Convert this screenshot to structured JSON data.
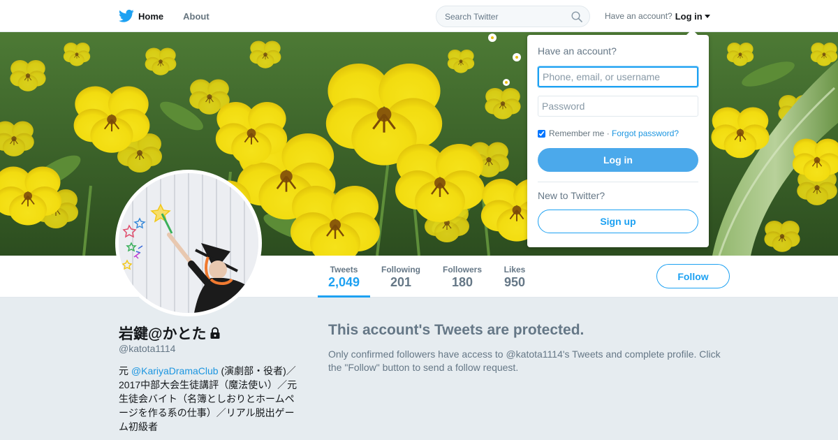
{
  "nav": {
    "home_label": "Home",
    "about_label": "About",
    "search_placeholder": "Search Twitter",
    "have_account_text": "Have an account?",
    "login_label": "Log in"
  },
  "profile": {
    "name": "岩鍵@かとた",
    "handle": "@katota1114",
    "bio_prefix": "元 ",
    "bio_mention": "@KariyaDramaClub",
    "bio_rest": " (演劇部・役者)／2017中部大会生徒講評（魔法使い）／元生徒会バイト（名簿としおりとホームページを作る系の仕事）／リアル脱出ゲーム初級者"
  },
  "stats": [
    {
      "label": "Tweets",
      "value": "2,049",
      "active": true
    },
    {
      "label": "Following",
      "value": "201",
      "active": false
    },
    {
      "label": "Followers",
      "value": "180",
      "active": false
    },
    {
      "label": "Likes",
      "value": "950",
      "active": false
    }
  ],
  "follow_label": "Follow",
  "protected": {
    "title": "This account's Tweets are protected.",
    "text": "Only confirmed followers have access to @katota1114's Tweets and complete profile. Click the \"Follow\" button to send a follow request."
  },
  "login_dropdown": {
    "heading": "Have an account?",
    "username_placeholder": "Phone, email, or username",
    "password_placeholder": "Password",
    "remember_label": "Remember me",
    "separator": " · ",
    "forgot_label": "Forgot password?",
    "remember_checked": true,
    "login_button": "Log in",
    "new_heading": "New to Twitter?",
    "signup_button": "Sign up"
  },
  "colors": {
    "accent": "#1da1f2",
    "link": "#1b95e0",
    "muted": "#657786",
    "background": "#e6ecf0"
  },
  "icons": [
    "twitter-bird-icon",
    "search-icon",
    "chevron-down-icon",
    "lock-icon"
  ]
}
